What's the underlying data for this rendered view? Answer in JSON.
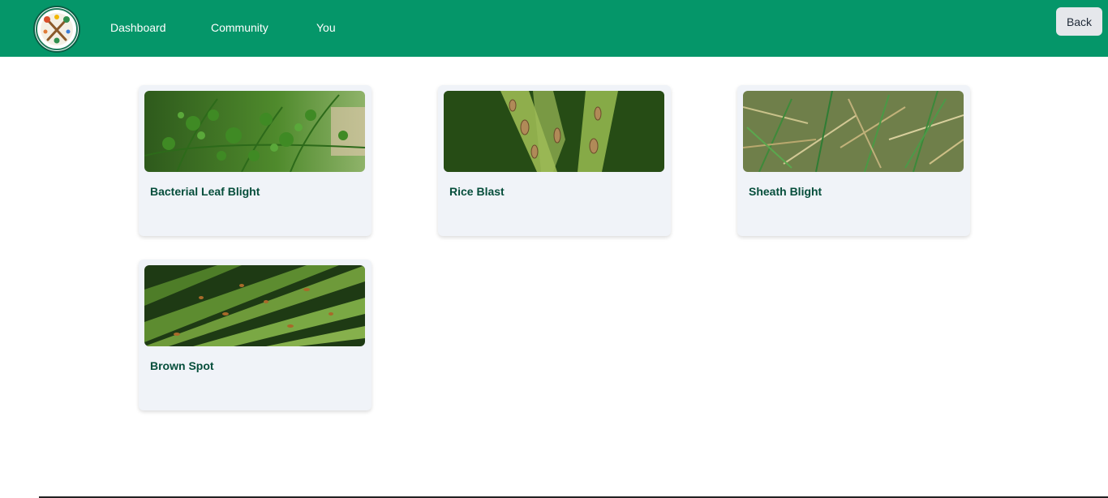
{
  "navbar": {
    "background": "#059669",
    "logo_icon": "garden-tools-icon",
    "links": [
      {
        "label": "Dashboard"
      },
      {
        "label": "Community"
      },
      {
        "label": "You"
      }
    ],
    "back_label": "Back"
  },
  "diseases": [
    {
      "title": "Bacterial Leaf Blight",
      "image": "carrot-foliage-photo"
    },
    {
      "title": "Rice Blast",
      "image": "blast-lesion-leaf-photo"
    },
    {
      "title": "Sheath Blight",
      "image": "grass-field-photo"
    },
    {
      "title": "Brown Spot",
      "image": "spotted-leaves-photo"
    }
  ],
  "colors": {
    "card_background": "#f0f3f8",
    "card_title": "#064e3b",
    "back_button": "#e5e7eb"
  }
}
